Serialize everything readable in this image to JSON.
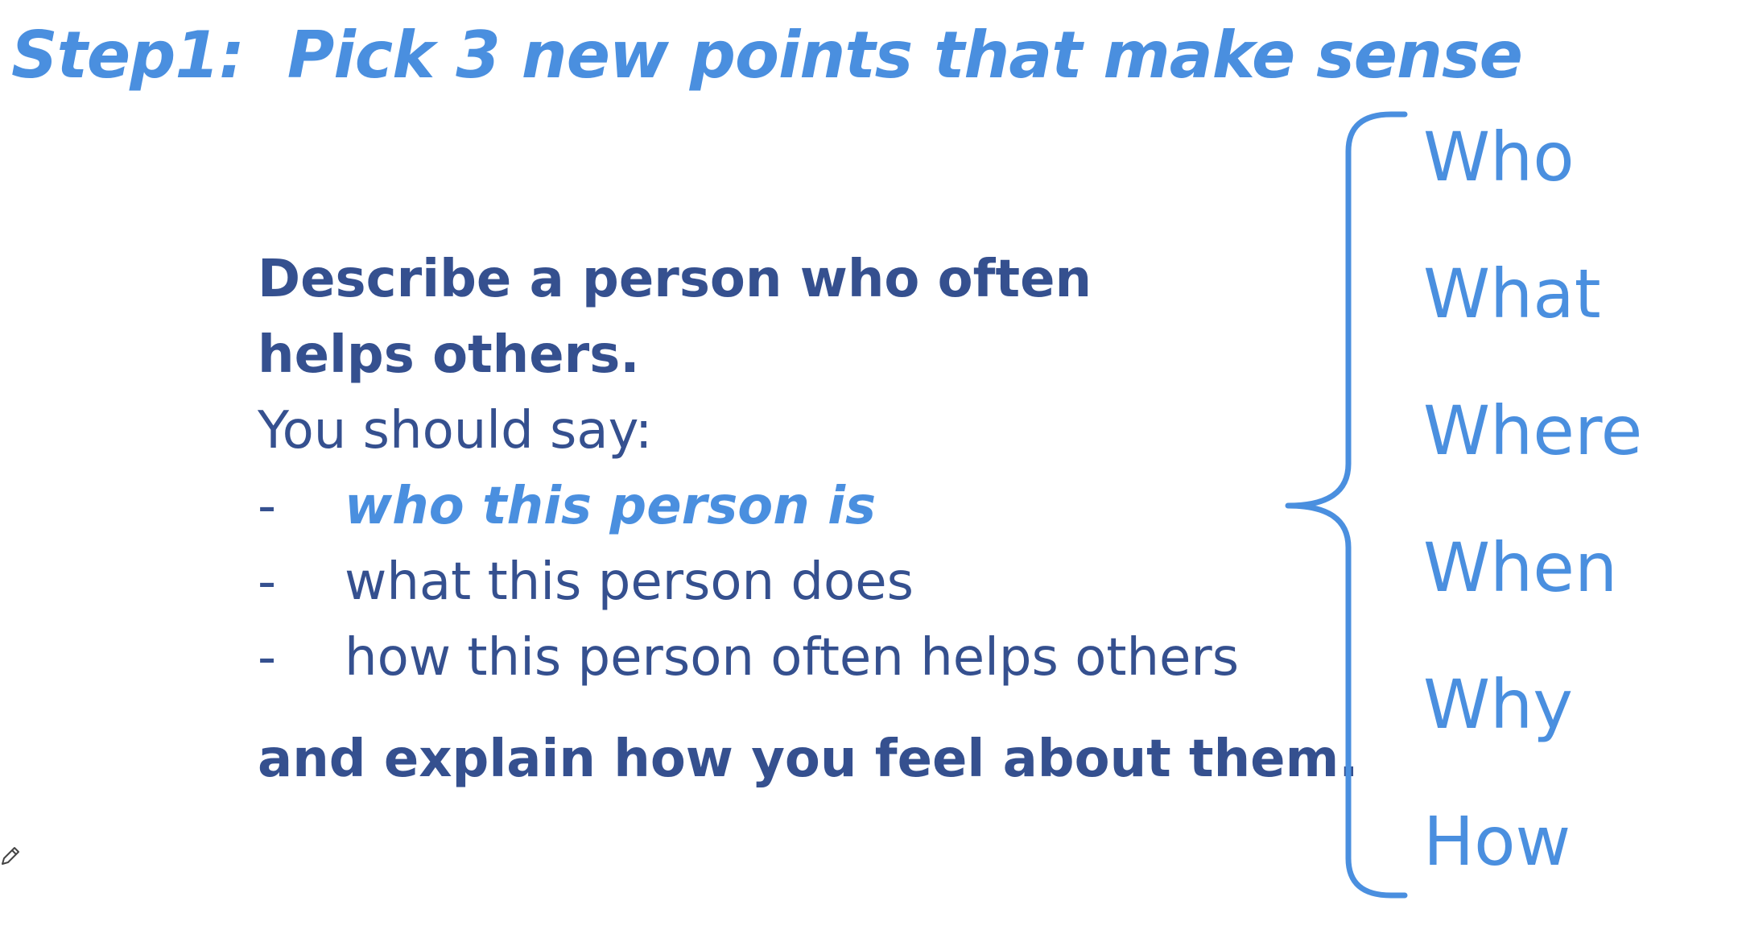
{
  "title": "Step1:  Pick 3 new points that make sense",
  "prompt": {
    "heading_line1": "Describe a person who often",
    "heading_line2": "helps others.",
    "intro": "You should say:",
    "bullets": [
      {
        "dash": "-",
        "text": "who this person is",
        "highlighted": true
      },
      {
        "dash": "-",
        "text": "what this person does",
        "highlighted": false
      },
      {
        "dash": "-",
        "text": "how this person often helps others",
        "highlighted": false
      }
    ],
    "closing": "and explain how you feel about them."
  },
  "question_words": [
    "Who",
    "What",
    "Where",
    "When",
    "Why",
    "How"
  ],
  "colors": {
    "accent_blue": "#4a8fdf",
    "text_navy": "#35508f",
    "background": "#ffffff"
  },
  "icons": {
    "brace": "curly-brace-icon",
    "pen": "pen-icon"
  }
}
